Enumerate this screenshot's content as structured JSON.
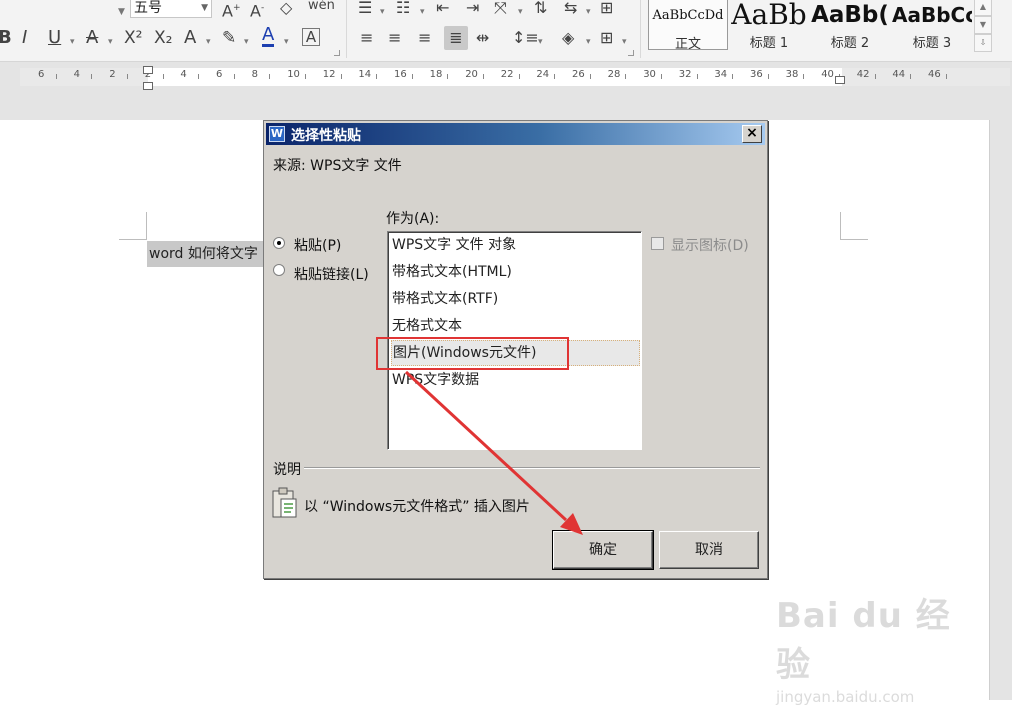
{
  "ribbon": {
    "font_size": "五号",
    "font_name": "",
    "superscript": "X²",
    "subscript": "X₂",
    "styles": [
      {
        "preview": "AaBbCcDd",
        "label": "正文"
      },
      {
        "preview": "AaBb",
        "label": "标题 1"
      },
      {
        "preview": "AaBb(",
        "label": "标题 2"
      },
      {
        "preview": "AaBbCc",
        "label": "标题 3"
      }
    ]
  },
  "ruler": {
    "labels": [
      "6",
      "4",
      "2",
      "2",
      "4",
      "6",
      "8",
      "10",
      "12",
      "14",
      "16",
      "18",
      "20",
      "22",
      "24",
      "26",
      "28",
      "30",
      "32",
      "34",
      "36",
      "38",
      "40",
      "42",
      "44",
      "46"
    ]
  },
  "document": {
    "text": "word 如何将文字"
  },
  "dialog": {
    "title": "选择性粘贴",
    "close": "×",
    "source_label": "来源: WPS文字 文件",
    "as_label": "作为(A):",
    "paste_option": "粘贴(P)",
    "paste_link_option": "粘贴链接(L)",
    "show_icon_label": "显示图标(D)",
    "list_items": [
      "WPS文字 文件 对象",
      "带格式文本(HTML)",
      "带格式文本(RTF)",
      "无格式文本",
      "图片(Windows元文件)",
      "WPS文字数据"
    ],
    "selected_index": 4,
    "description_label": "说明",
    "description_text": "以 “Windows元文件格式” 插入图片",
    "ok_button": "确定",
    "cancel_button": "取消"
  },
  "watermark": {
    "logo": "Bai du 经验",
    "url": "jingyan.baidu.com"
  },
  "colors": {
    "annotation_red": "#e03434",
    "title_bar_start": "#0a246a",
    "dialog_face": "#d6d3ce"
  }
}
